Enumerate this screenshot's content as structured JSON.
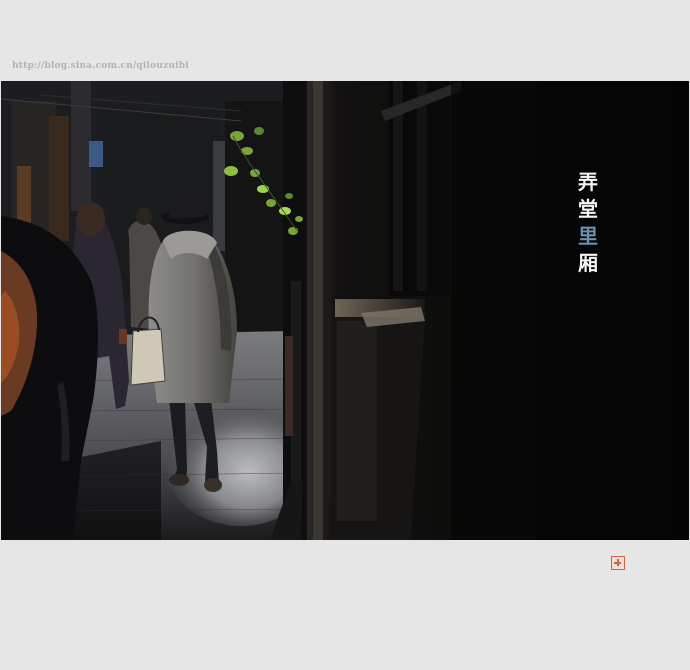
{
  "watermark": {
    "url_text": "http://blog.sina.com.cn/qilouzuibi"
  },
  "photo": {
    "title_chars": [
      "弄",
      "堂",
      "里",
      "厢"
    ],
    "title_color": "#f4f4f4",
    "title_accent_color": "#6f8fae",
    "seal_color": "#c9664b"
  }
}
